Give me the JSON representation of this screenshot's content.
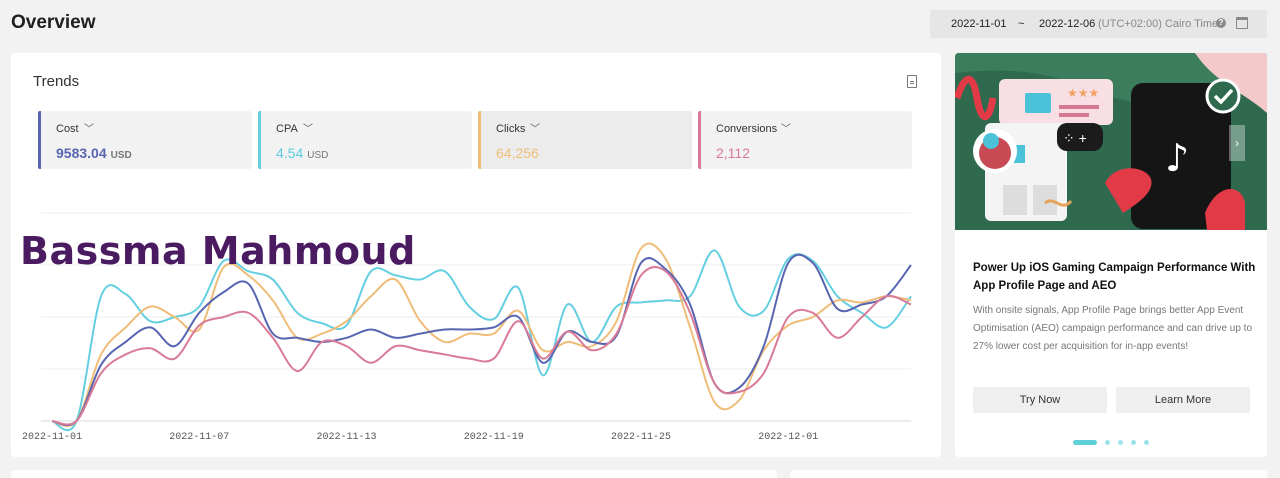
{
  "header": {
    "title": "Overview",
    "date_start": "2022-11-01",
    "date_separator": "~",
    "date_end": "2022-12-06",
    "timezone": "(UTC+02:00) Cairo Time"
  },
  "trends": {
    "title": "Trends",
    "metrics": [
      {
        "label": "Cost",
        "value": "9583.04",
        "unit": "USD",
        "color": "#5865b0"
      },
      {
        "label": "CPA",
        "value": "4.54",
        "unit": "USD",
        "color": "#64cfe0"
      },
      {
        "label": "Clicks",
        "value": "64,256",
        "unit": "",
        "color": "#efbd78"
      },
      {
        "label": "Conversions",
        "value": "2,112",
        "unit": "",
        "color": "#d97b97"
      }
    ],
    "watermark": "Bassma Mahmoud"
  },
  "chart_data": {
    "type": "line",
    "x_tick_labels": [
      "2022-11-01",
      "2022-11-07",
      "2022-11-13",
      "2022-11-19",
      "2022-11-25",
      "2022-12-01"
    ],
    "x": [
      "2022-11-01",
      "2022-11-02",
      "2022-11-03",
      "2022-11-04",
      "2022-11-05",
      "2022-11-06",
      "2022-11-07",
      "2022-11-08",
      "2022-11-09",
      "2022-11-10",
      "2022-11-11",
      "2022-11-12",
      "2022-11-13",
      "2022-11-14",
      "2022-11-15",
      "2022-11-16",
      "2022-11-17",
      "2022-11-18",
      "2022-11-19",
      "2022-11-20",
      "2022-11-21",
      "2022-11-22",
      "2022-11-23",
      "2022-11-24",
      "2022-11-25",
      "2022-11-26",
      "2022-11-27",
      "2022-11-28",
      "2022-11-29",
      "2022-11-30",
      "2022-12-01",
      "2022-12-02",
      "2022-12-03",
      "2022-12-04",
      "2022-12-05",
      "2022-12-06"
    ],
    "ylim": [
      0,
      1
    ],
    "grid": true,
    "series": [
      {
        "color": "#64cfe0",
        "values": [
          0.0,
          0.0,
          0.6,
          0.61,
          0.48,
          0.5,
          0.55,
          0.77,
          0.72,
          0.68,
          0.52,
          0.47,
          0.46,
          0.72,
          0.7,
          0.68,
          0.72,
          0.55,
          0.49,
          0.64,
          0.22,
          0.56,
          0.38,
          0.55,
          0.57,
          0.58,
          0.6,
          0.82,
          0.55,
          0.53,
          0.78,
          0.77,
          0.6,
          0.52,
          0.45,
          0.6
        ]
      },
      {
        "color": "#efbd78",
        "values": [
          0.0,
          0.0,
          0.32,
          0.45,
          0.55,
          0.5,
          0.44,
          0.74,
          0.7,
          0.58,
          0.4,
          0.42,
          0.48,
          0.6,
          0.68,
          0.48,
          0.38,
          0.42,
          0.42,
          0.53,
          0.34,
          0.38,
          0.36,
          0.48,
          0.83,
          0.78,
          0.45,
          0.09,
          0.1,
          0.34,
          0.46,
          0.5,
          0.58,
          0.57,
          0.6,
          0.58
        ]
      },
      {
        "color": "#5865b0",
        "values": [
          0.0,
          0.0,
          0.27,
          0.38,
          0.45,
          0.36,
          0.52,
          0.62,
          0.66,
          0.42,
          0.4,
          0.38,
          0.4,
          0.44,
          0.4,
          0.42,
          0.44,
          0.44,
          0.45,
          0.5,
          0.28,
          0.43,
          0.38,
          0.41,
          0.76,
          0.73,
          0.56,
          0.18,
          0.16,
          0.36,
          0.76,
          0.76,
          0.54,
          0.56,
          0.6,
          0.75
        ]
      },
      {
        "color": "#d97b97",
        "values": [
          0.0,
          0.0,
          0.23,
          0.32,
          0.35,
          0.3,
          0.46,
          0.5,
          0.52,
          0.4,
          0.24,
          0.38,
          0.36,
          0.28,
          0.36,
          0.34,
          0.32,
          0.3,
          0.3,
          0.48,
          0.3,
          0.43,
          0.34,
          0.42,
          0.7,
          0.72,
          0.52,
          0.18,
          0.14,
          0.23,
          0.5,
          0.52,
          0.4,
          0.5,
          0.6,
          0.56
        ]
      }
    ]
  },
  "promo": {
    "title": "Power Up iOS Gaming Campaign Performance With App Profile Page and AEO",
    "description": "With onsite signals, App Profile Page brings better App Event Optimisation (AEO) campaign performance and can drive up to 27% lower cost per acquisition for in-app events!",
    "try_label": "Try Now",
    "learn_label": "Learn More",
    "next_glyph": "›",
    "slides": 5,
    "active_slide": 0,
    "icons": [
      "tiktok-icon",
      "check-icon",
      "game-controller-icon",
      "star-icon"
    ]
  }
}
